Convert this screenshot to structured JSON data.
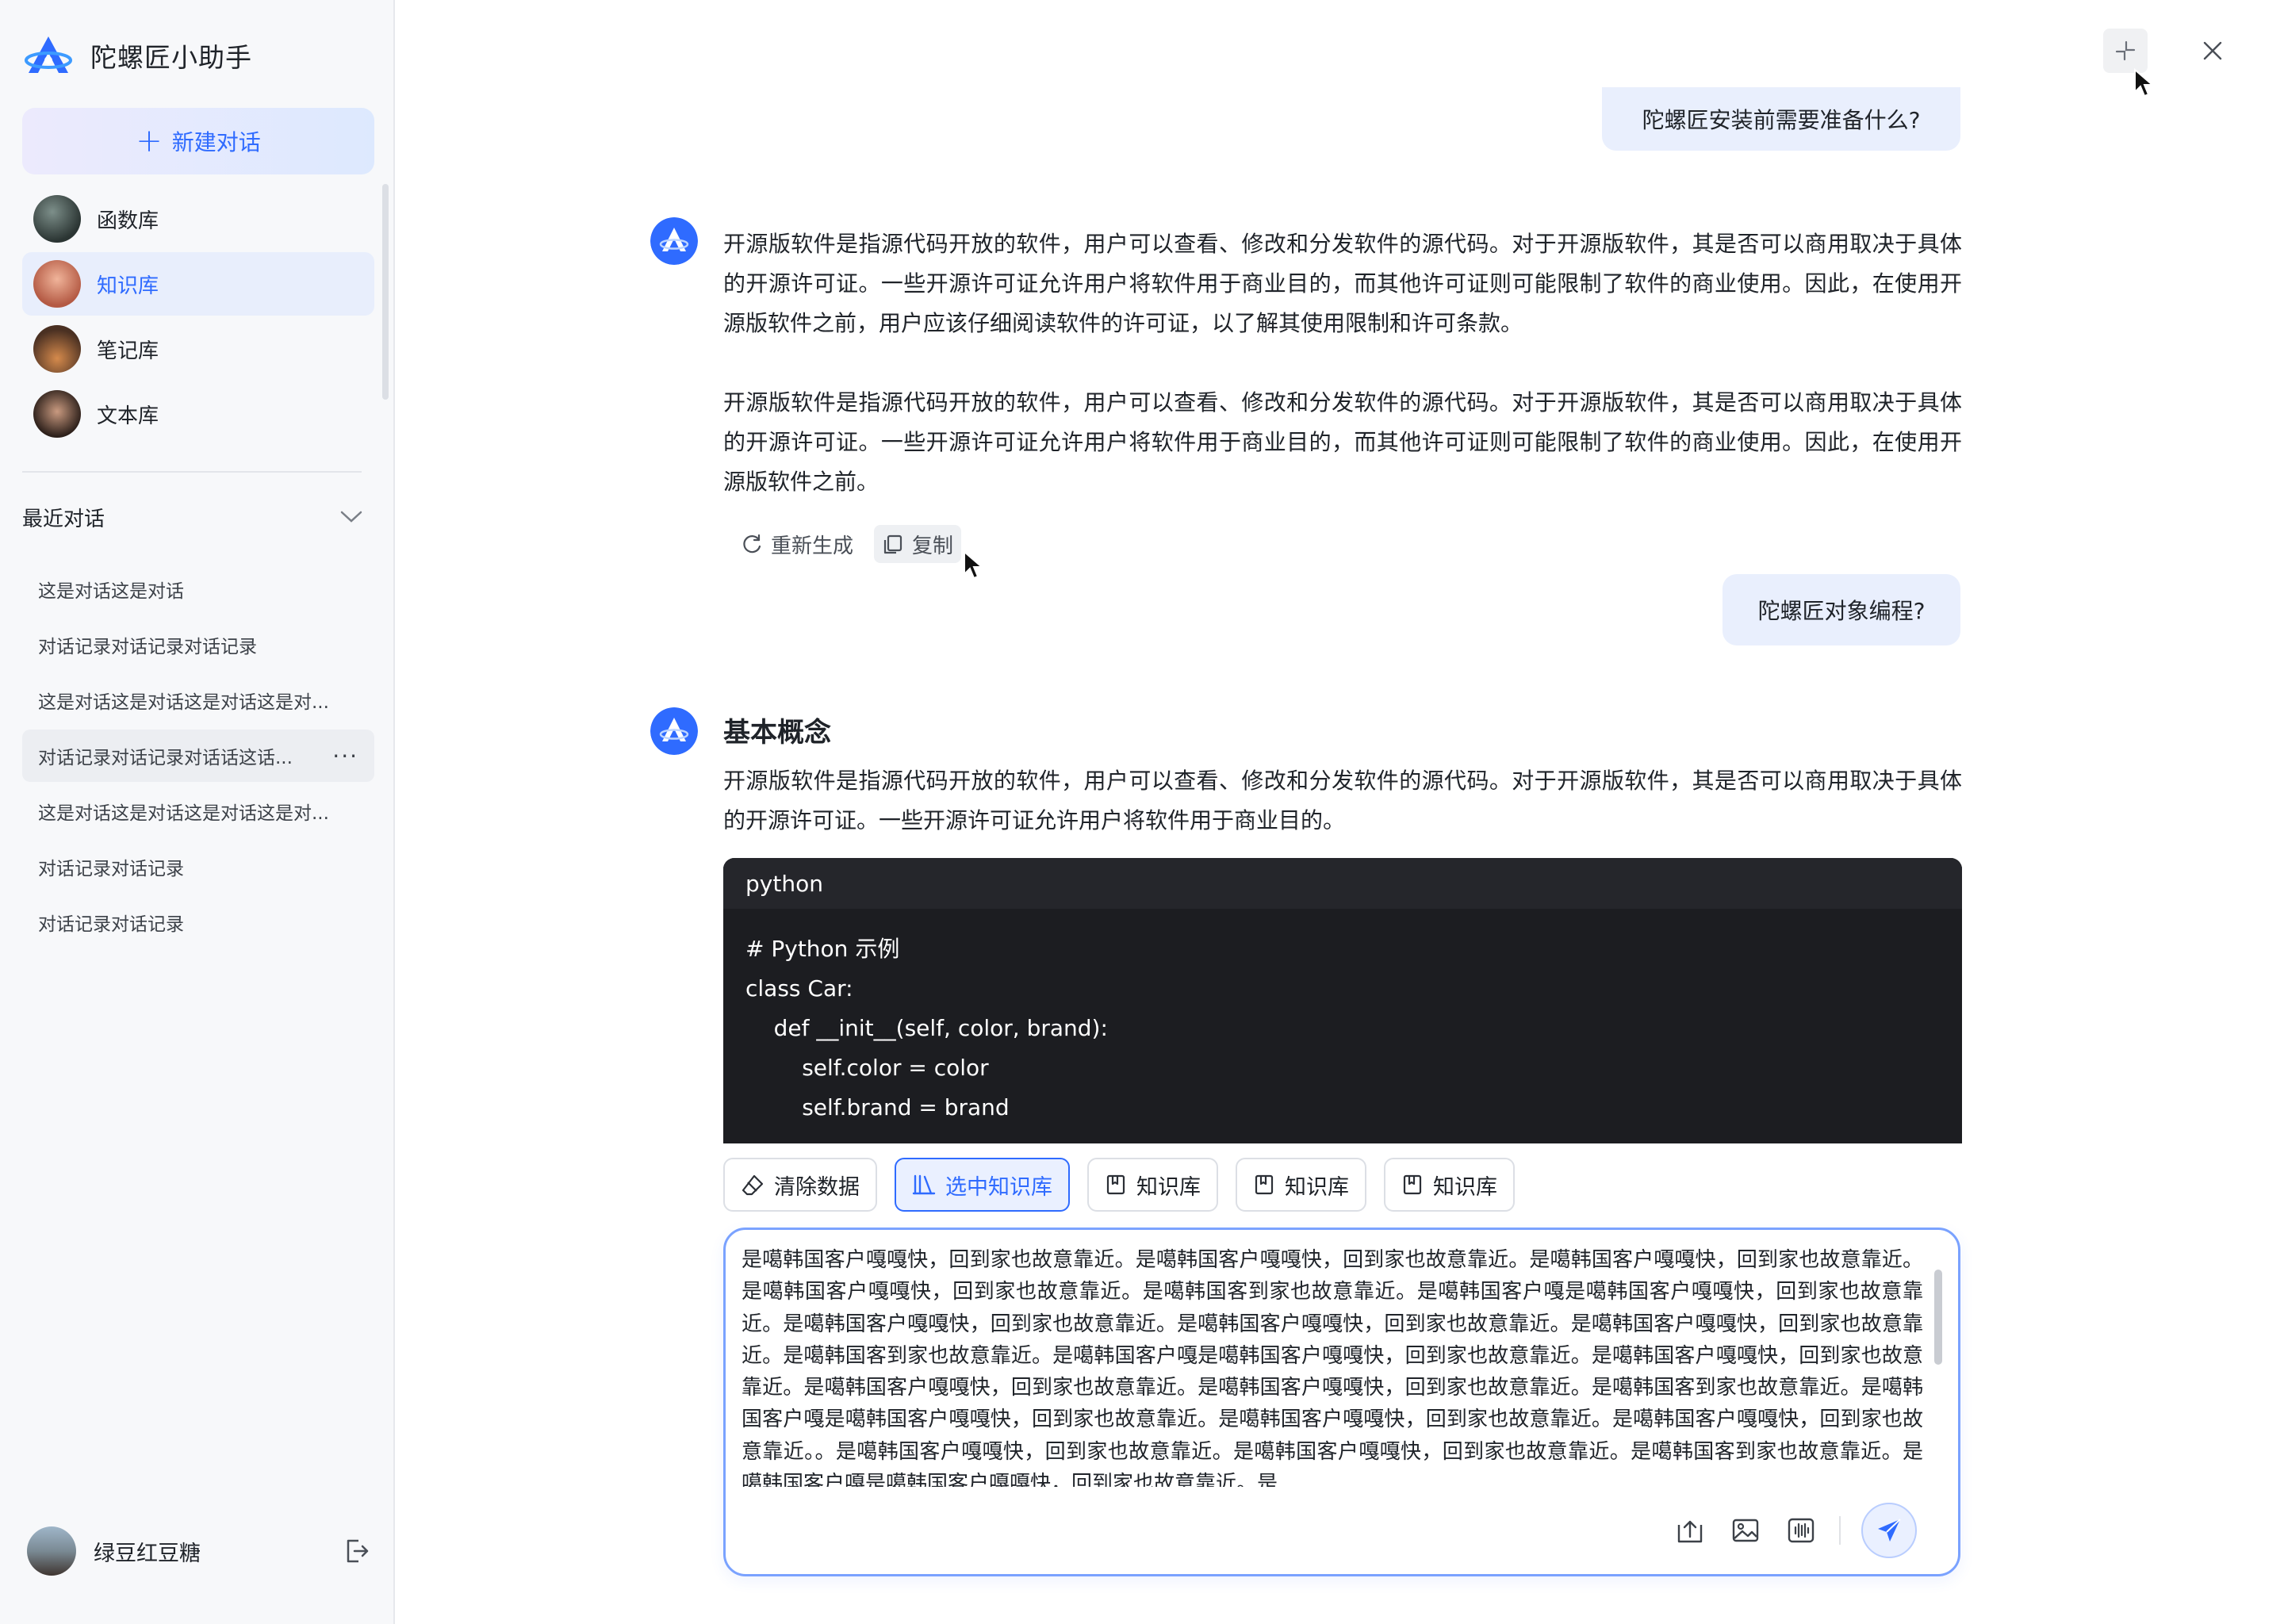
{
  "sidebar": {
    "brand_title": "陀螺匠小助手",
    "new_chat_label": "新建对话",
    "apps": [
      {
        "label": "函数库",
        "avatar_color": "#3a4a48"
      },
      {
        "label": "知识库",
        "avatar_color": "#c7765d",
        "active": true
      },
      {
        "label": "笔记库",
        "avatar_color": "#6b4a36"
      },
      {
        "label": "文本库",
        "avatar_color": "#3b2a22"
      }
    ],
    "recent_title": "最近对话",
    "recent": [
      "这是对话这是对话",
      "对话记录对话记录对话记录",
      "这是对话这是对话这是对话这是对...",
      "对话记录对话记录对话话这话...",
      "这是对话这是对话这是对话这是对...",
      "对话记录对话记录",
      "对话记录对话记录"
    ],
    "recent_more": "···",
    "user_name": "绿豆红豆糖"
  },
  "chat": {
    "user_q1": "陀螺匠安装前需要准备什么?",
    "answer1_p1": "开源版软件是指源代码开放的软件，用户可以查看、修改和分发软件的源代码。对于开源版软件，其是否可以商用取决于具体的开源许可证。一些开源许可证允许用户将软件用于商业目的，而其他许可证则可能限制了软件的商业使用。因此，在使用开源版软件之前，用户应该仔细阅读软件的许可证，以了解其使用限制和许可条款。",
    "answer1_p2": "开源版软件是指源代码开放的软件，用户可以查看、修改和分发软件的源代码。对于开源版软件，其是否可以商用取决于具体的开源许可证。一些开源许可证允许用户将软件用于商业目的，而其他许可证则可能限制了软件的商业使用。因此，在使用开源版软件之前。",
    "regenerate_label": "重新生成",
    "copy_label": "复制",
    "user_q2": "陀螺匠对象编程?",
    "section_title": "基本概念",
    "answer2_p1": "开源版软件是指源代码开放的软件，用户可以查看、修改和分发软件的源代码。对于开源版软件，其是否可以商用取决于具体的开源许可证。一些开源许可证允许用户将软件用于商业目的。",
    "code_lang": "python",
    "code": "# Python 示例\nclass Car:\n    def __init__(self, color, brand):\n        self.color = color\n        self.brand = brand"
  },
  "toolbar": {
    "clear_label": "清除数据",
    "selected_kb_label": "选中知识库",
    "kb_chips": [
      "知识库",
      "知识库",
      "知识库"
    ]
  },
  "composer": {
    "value": "是噶韩国客户嘎嘎快，回到家也故意靠近。是噶韩国客户嘎嘎快，回到家也故意靠近。是噶韩国客户嘎嘎快，回到家也故意靠近。是噶韩国客户嘎嘎快，回到家也故意靠近。是噶韩国客到家也故意靠近。是噶韩国客户嘎是噶韩国客户嘎嘎快，回到家也故意靠近。是噶韩国客户嘎嘎快，回到家也故意靠近。是噶韩国客户嘎嘎快，回到家也故意靠近。是噶韩国客户嘎嘎快，回到家也故意靠近。是噶韩国客到家也故意靠近。是噶韩国客户嘎是噶韩国客户嘎嘎快，回到家也故意靠近。是噶韩国客户嘎嘎快，回到家也故意靠近。是噶韩国客户嘎嘎快，回到家也故意靠近。是噶韩国客户嘎嘎快，回到家也故意靠近。是噶韩国客到家也故意靠近。是噶韩国客户嘎是噶韩国客户嘎嘎快，回到家也故意靠近。是噶韩国客户嘎嘎快，回到家也故意靠近。是噶韩国客户嘎嘎快，回到家也故意靠近。。是噶韩国客户嘎嘎快，回到家也故意靠近。是噶韩国客户嘎嘎快，回到家也故意靠近。是噶韩国客到家也故意靠近。是噶韩国客户嘎是噶韩国客户嘎嘎快，回到家也故意靠近。是"
  },
  "colors": {
    "accent": "#2f6bff",
    "user_bubble": "#e9effd",
    "code_bg": "#1c1d21"
  }
}
